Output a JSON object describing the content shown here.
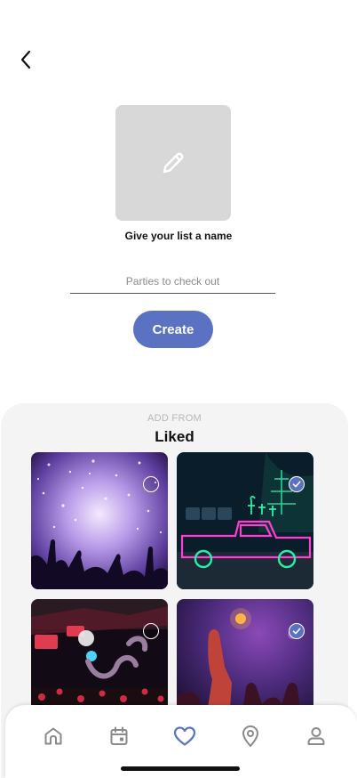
{
  "header": {
    "back_icon": "chevron-left-icon"
  },
  "list_cover": {
    "icon": "pencil-icon",
    "background": "#d8d8d8"
  },
  "prompt": "Give your list a name",
  "name_field": {
    "placeholder": "Parties to check out",
    "value": ""
  },
  "create_label": "Create",
  "add_from": {
    "caption": "ADD FROM",
    "title": "Liked",
    "items": [
      {
        "name": "confetti-concert-photo",
        "selected": false
      },
      {
        "name": "neon-truck-photo",
        "selected": true
      },
      {
        "name": "club-stage-photo",
        "selected": false
      },
      {
        "name": "crowd-hands-photo",
        "selected": true
      }
    ]
  },
  "tabbar": {
    "tabs": [
      {
        "name": "home",
        "icon": "home-icon",
        "active": false
      },
      {
        "name": "calendar",
        "icon": "calendar-icon",
        "active": false
      },
      {
        "name": "liked",
        "icon": "heart-icon",
        "active": true
      },
      {
        "name": "map",
        "icon": "location-pin-icon",
        "active": false
      },
      {
        "name": "profile",
        "icon": "user-icon",
        "active": false
      }
    ]
  },
  "colors": {
    "accent": "#5b72c2",
    "icon_inactive": "#8a8a8a",
    "sheet": "#f4f4f4"
  }
}
